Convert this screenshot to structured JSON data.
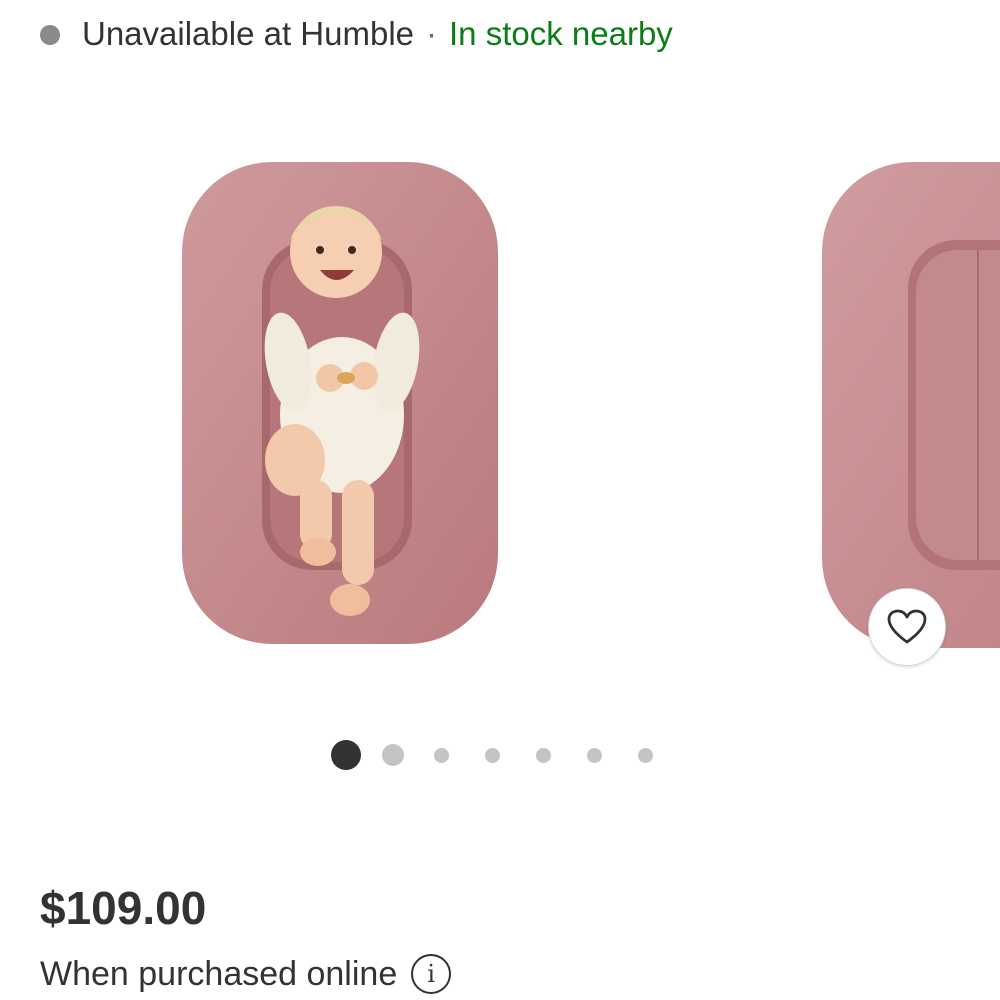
{
  "availability": {
    "unavailable_text": "Unavailable at Humble",
    "separator": "·",
    "in_stock_text": "In stock nearby",
    "in_stock_color": "#0b7d16",
    "dot_color": "#8a8a8a"
  },
  "carousel": {
    "slides": [
      {
        "icon": "baby-lounger-with-baby-image"
      },
      {
        "icon": "baby-lounger-image"
      }
    ],
    "total_images": 7,
    "active_index": 0,
    "favorite_icon": "heart-icon"
  },
  "price": {
    "amount": "$109.00",
    "note": "When purchased online",
    "info_label": "i"
  }
}
